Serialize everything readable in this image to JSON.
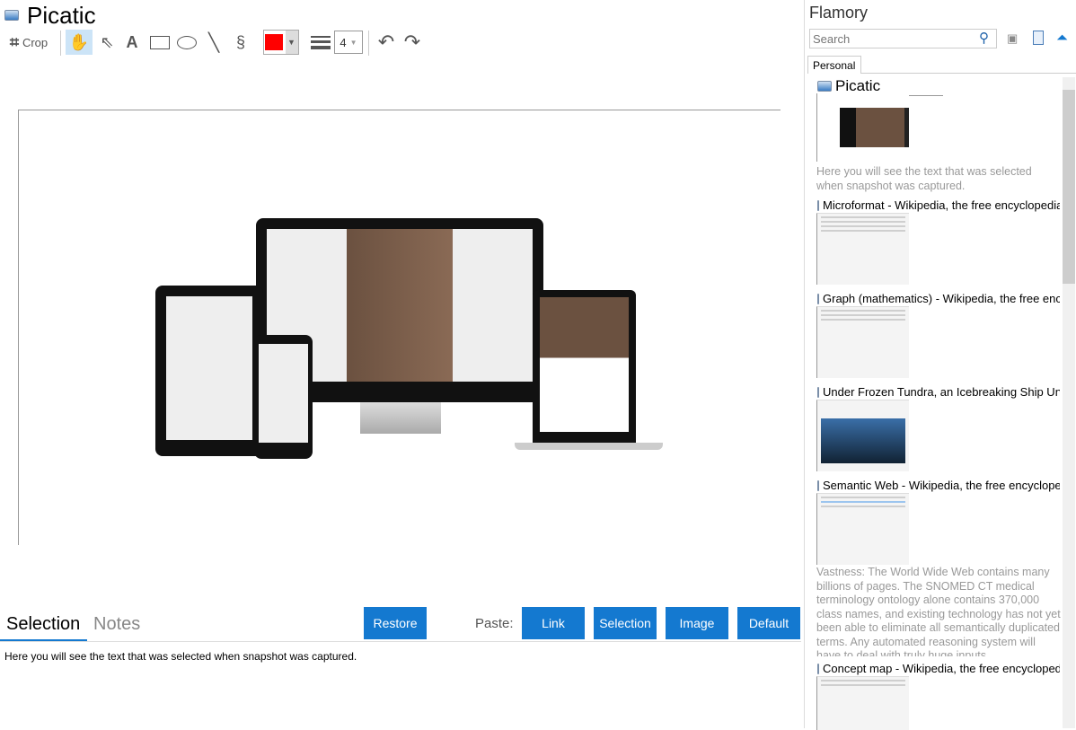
{
  "app": {
    "title": "Picatic"
  },
  "toolbar": {
    "crop_label": "Crop",
    "line_width": "4",
    "color": "#ff0000"
  },
  "bottom": {
    "tabs": [
      {
        "label": "Selection"
      },
      {
        "label": "Notes"
      }
    ],
    "restore": "Restore",
    "paste_label": "Paste:",
    "paste_buttons": [
      "Link",
      "Selection",
      "Image",
      "Default"
    ],
    "selection_text": "Here you will see the text that was selected when snapshot was captured."
  },
  "sidebar": {
    "title": "Flamory",
    "search_placeholder": "Search",
    "tab": "Personal",
    "items": [
      {
        "title": "Picatic",
        "desc": "Here you will see the text that was selected when snapshot was captured."
      },
      {
        "title": "Microformat - Wikipedia, the free encyclopedia"
      },
      {
        "title": "Graph (mathematics) - Wikipedia, the free ency"
      },
      {
        "title": "Under Frozen Tundra, an Icebreaking Ship Unco"
      },
      {
        "title": "Semantic Web - Wikipedia, the free encycloped",
        "desc": "Vastness: The World Wide Web contains many billions of pages. The SNOMED CT medical terminology ontology alone contains 370,000 class names, and existing technology has not yet been able to eliminate all semantically duplicated terms. Any automated reasoning system will have to deal with truly huge inputs."
      },
      {
        "title": "Concept map - Wikipedia, the free encyclopedia"
      }
    ]
  },
  "colors": {
    "accent": "#1479d0",
    "selected_tool": "#cce4f7"
  }
}
